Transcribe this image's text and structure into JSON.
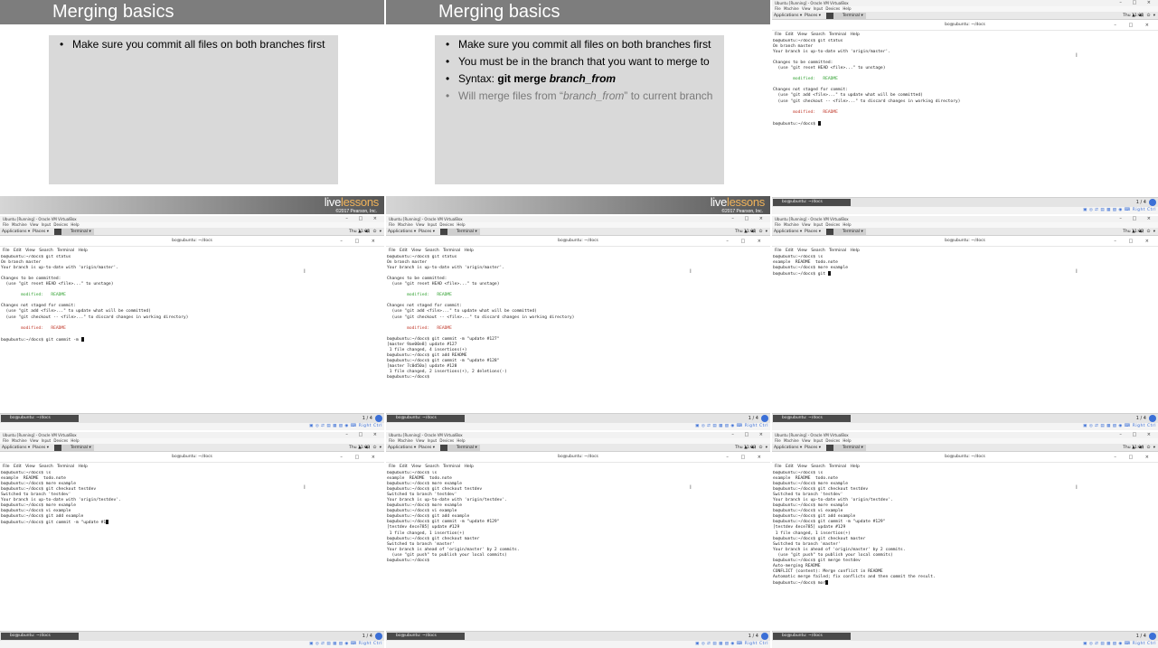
{
  "slides": [
    {
      "title": "Merging basics",
      "bullets": [
        {
          "text": "Make sure you commit all files on both branches first",
          "style": "normal"
        }
      ]
    },
    {
      "title": "Merging basics",
      "bullets": [
        {
          "text": "Make sure you commit all files on both branches first",
          "style": "normal"
        },
        {
          "text": "You must be in the branch that you want to merge to",
          "style": "normal"
        },
        {
          "prefix": "Syntax: ",
          "bold": "git merge ",
          "bolditalic": "branch_from",
          "style": "syntax"
        },
        {
          "prefix": "Will merge files from “",
          "italic": "branch_from",
          "suffix": "” to current branch",
          "style": "faded"
        }
      ]
    }
  ],
  "brand": {
    "live": "live",
    "lessons": "lessons",
    "copyright": "©2017 Pearson, Inc.",
    "accent_color": "#f0b35a"
  },
  "vm_window": {
    "title": "Ubuntu [Running] - Oracle VM VirtualBox",
    "menu": "File  Machine  View  Input  Devices  Help",
    "window_buttons": "– □ ×"
  },
  "gnome": {
    "applications": "Applications ▾",
    "places": "Places ▾",
    "terminal_chip": "Terminal ▾",
    "system_icons": "▲ ◀) ⏻ ▾"
  },
  "terminal": {
    "title": "bo@ubuntu: ~/docs",
    "menu": "File  Edit  View  Search  Terminal  Help",
    "buttons": "– □ ×",
    "task_label": "bo@ubuntu: ~/docs",
    "workspace": "1 / 4",
    "status_icons": "▣ ◎ ⇄ ▤ ▦ ▧ ◉ ⌨ Right Ctrl"
  },
  "desktops": [
    {
      "clock": "Thu 11:01",
      "lines": [
        {
          "t": "bo@ubuntu:~/docs$ git status"
        },
        {
          "t": "On branch master"
        },
        {
          "t": "Your branch is up-to-date with 'origin/master'."
        },
        {
          "t": ""
        },
        {
          "t": "Changes to be committed:"
        },
        {
          "t": "  (use \"git reset HEAD <file>...\" to unstage)"
        },
        {
          "t": ""
        },
        {
          "t": "        modified:   README",
          "c": "green"
        },
        {
          "t": ""
        },
        {
          "t": "Changes not staged for commit:"
        },
        {
          "t": "  (use \"git add <file>...\" to update what will be committed)"
        },
        {
          "t": "  (use \"git checkout -- <file>...\" to discard changes in working directory)"
        },
        {
          "t": ""
        },
        {
          "t": "        modified:   README",
          "c": "red"
        },
        {
          "t": ""
        },
        {
          "t": "bo@ubuntu:~/docs$ ",
          "cursor": true
        }
      ]
    },
    {
      "clock": "Thu 11:01",
      "lines": [
        {
          "t": "bo@ubuntu:~/docs$ git status"
        },
        {
          "t": "On branch master"
        },
        {
          "t": "Your branch is up-to-date with 'origin/master'."
        },
        {
          "t": ""
        },
        {
          "t": "Changes to be committed:"
        },
        {
          "t": "  (use \"git reset HEAD <file>...\" to unstage)"
        },
        {
          "t": ""
        },
        {
          "t": "        modified:   README",
          "c": "green"
        },
        {
          "t": ""
        },
        {
          "t": "Changes not staged for commit:"
        },
        {
          "t": "  (use \"git add <file>...\" to update what will be committed)"
        },
        {
          "t": "  (use \"git checkout -- <file>...\" to discard changes in working directory)"
        },
        {
          "t": ""
        },
        {
          "t": "        modified:   README",
          "c": "red"
        },
        {
          "t": ""
        },
        {
          "t": "bo@ubuntu:~/docs$ git commit -m ",
          "cursor": true
        }
      ]
    },
    {
      "clock": "Thu 11:01",
      "lines": [
        {
          "t": "bo@ubuntu:~/docs$ git status"
        },
        {
          "t": "On branch master"
        },
        {
          "t": "Your branch is up-to-date with 'origin/master'."
        },
        {
          "t": ""
        },
        {
          "t": "Changes to be committed:"
        },
        {
          "t": "  (use \"git reset HEAD <file>...\" to unstage)"
        },
        {
          "t": ""
        },
        {
          "t": "        modified:   README",
          "c": "green"
        },
        {
          "t": ""
        },
        {
          "t": "Changes not staged for commit:"
        },
        {
          "t": "  (use \"git add <file>...\" to update what will be committed)"
        },
        {
          "t": "  (use \"git checkout -- <file>...\" to discard changes in working directory)"
        },
        {
          "t": ""
        },
        {
          "t": "        modified:   README",
          "c": "red"
        },
        {
          "t": ""
        },
        {
          "t": "bo@ubuntu:~/docs$ git commit -m \"update #127\""
        },
        {
          "t": "[master 9ae00e8] update #127"
        },
        {
          "t": " 1 file changed, 4 insertions(+)"
        },
        {
          "t": "bo@ubuntu:~/docs$ git add README"
        },
        {
          "t": "bo@ubuntu:~/docs$ git commit -m \"update #128\""
        },
        {
          "t": "[master 7c0d50a] update #128"
        },
        {
          "t": " 1 file changed, 2 insertions(+), 2 deletions(-)"
        },
        {
          "t": "bo@ubuntu:~/docs$ "
        }
      ]
    },
    {
      "clock": "Thu 11:02",
      "lines": [
        {
          "t": "bo@ubuntu:~/docs$ ls"
        },
        {
          "t": "example  README  todo.note"
        },
        {
          "t": "bo@ubuntu:~/docs$ more example"
        },
        {
          "t": "bo@ubuntu:~/docs$ git ",
          "cursor": true
        }
      ]
    },
    {
      "clock": "Thu 11:03",
      "lines": [
        {
          "t": "bo@ubuntu:~/docs$ ls"
        },
        {
          "t": "example  README  todo.note"
        },
        {
          "t": "bo@ubuntu:~/docs$ more example"
        },
        {
          "t": "bo@ubuntu:~/docs$ git checkout testdev"
        },
        {
          "t": "Switched to branch 'testdev'"
        },
        {
          "t": "Your branch is up-to-date with 'origin/testdev'."
        },
        {
          "t": "bo@ubuntu:~/docs$ more example"
        },
        {
          "t": "bo@ubuntu:~/docs$ vi example"
        },
        {
          "t": "bo@ubuntu:~/docs$ git add example"
        },
        {
          "t": "bo@ubuntu:~/docs$ git commit -m \"update #1",
          "cursor": true
        }
      ]
    },
    {
      "clock": "Thu 11:03",
      "lines": [
        {
          "t": "bo@ubuntu:~/docs$ ls"
        },
        {
          "t": "example  README  todo.note"
        },
        {
          "t": "bo@ubuntu:~/docs$ more example"
        },
        {
          "t": "bo@ubuntu:~/docs$ git checkout testdev"
        },
        {
          "t": "Switched to branch 'testdev'"
        },
        {
          "t": "Your branch is up-to-date with 'origin/testdev'."
        },
        {
          "t": "bo@ubuntu:~/docs$ more example"
        },
        {
          "t": "bo@ubuntu:~/docs$ vi example"
        },
        {
          "t": "bo@ubuntu:~/docs$ git add example"
        },
        {
          "t": "bo@ubuntu:~/docs$ git commit -m \"update #129\""
        },
        {
          "t": "[testdev 4ece785] update #129"
        },
        {
          "t": " 1 file changed, 1 insertion(+)"
        },
        {
          "t": "bo@ubuntu:~/docs$ git checkout master"
        },
        {
          "t": "Switched to branch 'master'"
        },
        {
          "t": "Your branch is ahead of 'origin/master' by 2 commits."
        },
        {
          "t": "  (use \"git push\" to publish your local commits)"
        },
        {
          "t": "bo@ubuntu:~/docs$ "
        }
      ]
    },
    {
      "clock": "Thu 11:04",
      "lines": [
        {
          "t": "bo@ubuntu:~/docs$ ls"
        },
        {
          "t": "example  README  todo.note"
        },
        {
          "t": "bo@ubuntu:~/docs$ more example"
        },
        {
          "t": "bo@ubuntu:~/docs$ git checkout testdev"
        },
        {
          "t": "Switched to branch 'testdev'"
        },
        {
          "t": "Your branch is up-to-date with 'origin/testdev'."
        },
        {
          "t": "bo@ubuntu:~/docs$ more example"
        },
        {
          "t": "bo@ubuntu:~/docs$ vi example"
        },
        {
          "t": "bo@ubuntu:~/docs$ git add example"
        },
        {
          "t": "bo@ubuntu:~/docs$ git commit -m \"update #129\""
        },
        {
          "t": "[testdev 4ece785] update #129"
        },
        {
          "t": " 1 file changed, 1 insertion(+)"
        },
        {
          "t": "bo@ubuntu:~/docs$ git checkout master"
        },
        {
          "t": "Switched to branch 'master'"
        },
        {
          "t": "Your branch is ahead of 'origin/master' by 2 commits."
        },
        {
          "t": "  (use \"git push\" to publish your local commits)"
        },
        {
          "t": "bo@ubuntu:~/docs$ git merge testdev"
        },
        {
          "t": "Auto-merging README"
        },
        {
          "t": "CONFLICT (content): Merge conflict in README"
        },
        {
          "t": "Automatic merge failed; fix conflicts and then commit the result."
        },
        {
          "t": "bo@ubuntu:~/docs$ mor",
          "cursor": true
        }
      ]
    }
  ],
  "ibeam_glyph": "I"
}
